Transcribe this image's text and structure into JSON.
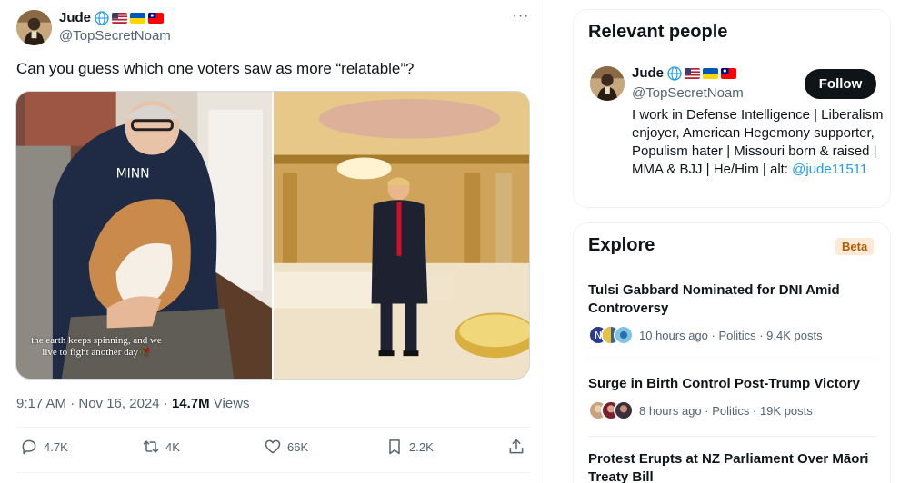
{
  "post": {
    "author_name": "Jude",
    "author_badges": [
      "globe-icon",
      "us-flag",
      "ukraine-flag",
      "taiwan-flag"
    ],
    "author_handle": "@TopSecretNoam",
    "text": "Can you guess which one voters saw as more “relatable”?",
    "image_caption": "the earth keeps spinning, and we live to fight another day🥀",
    "time": "9:17 AM · Nov 16, 2024 · ",
    "views_count": "14.7M",
    "views_label": " Views",
    "actions": {
      "replies": "4.7K",
      "reposts": "4K",
      "likes": "66K",
      "bookmarks": "2.2K"
    }
  },
  "relevant_people": {
    "title": "Relevant people",
    "name": "Jude",
    "handle": "@TopSecretNoam",
    "follow_label": "Follow",
    "bio": "I work in Defense Intelligence | Liberalism enjoyer, American Hegemony supporter, Populism hater | Missouri born & raised | MMA & BJJ | He/Him | alt: ",
    "bio_link": "@jude11511"
  },
  "explore": {
    "title": "Explore",
    "badge": "Beta",
    "trends": [
      {
        "title": "Tulsi Gabbard Nominated for DNI Amid Controversy",
        "meta": "10 hours ago · Politics · 9.4K posts"
      },
      {
        "title": "Surge in Birth Control Post-Trump Victory",
        "meta": "8 hours ago · Politics · 19K posts"
      },
      {
        "title": "Protest Erupts at NZ Parliament Over Māori Treaty Bill",
        "meta": ""
      }
    ]
  },
  "colors": {
    "text": "#0f1419",
    "secondary": "#536471",
    "link": "#1d9bf0",
    "border": "#eff3f4",
    "follow_bg": "#0f1419"
  }
}
